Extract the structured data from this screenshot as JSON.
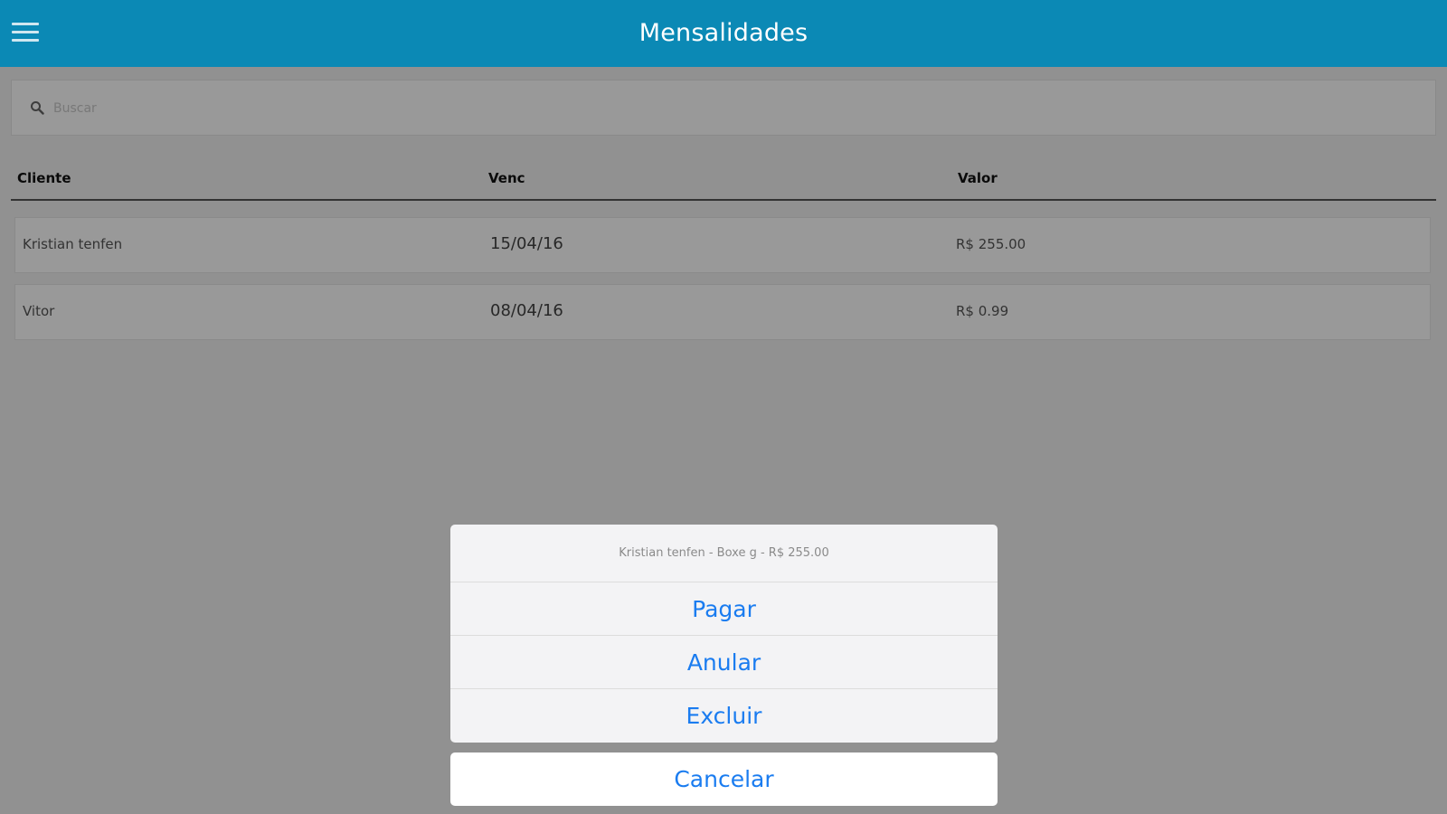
{
  "header": {
    "title": "Mensalidades"
  },
  "search": {
    "placeholder": "Buscar"
  },
  "table": {
    "columns": [
      "Cliente",
      "Venc",
      "Valor"
    ],
    "rows": [
      {
        "cliente": "Kristian tenfen",
        "venc": "15/04/16",
        "valor": "R$ 255.00"
      },
      {
        "cliente": "Vitor",
        "venc": "08/04/16",
        "valor": "R$ 0.99"
      }
    ]
  },
  "action_sheet": {
    "title": "Kristian tenfen - Boxe g - R$ 255.00",
    "buttons": [
      "Pagar",
      "Anular",
      "Excluir"
    ],
    "cancel": "Cancelar"
  },
  "colors": {
    "header_bg": "#0b89b5",
    "action_text": "#1a7cf0",
    "overlay": "rgba(0,0,0,0.4)"
  },
  "icons": {
    "menu": "hamburger-menu-icon",
    "search": "search-icon"
  }
}
